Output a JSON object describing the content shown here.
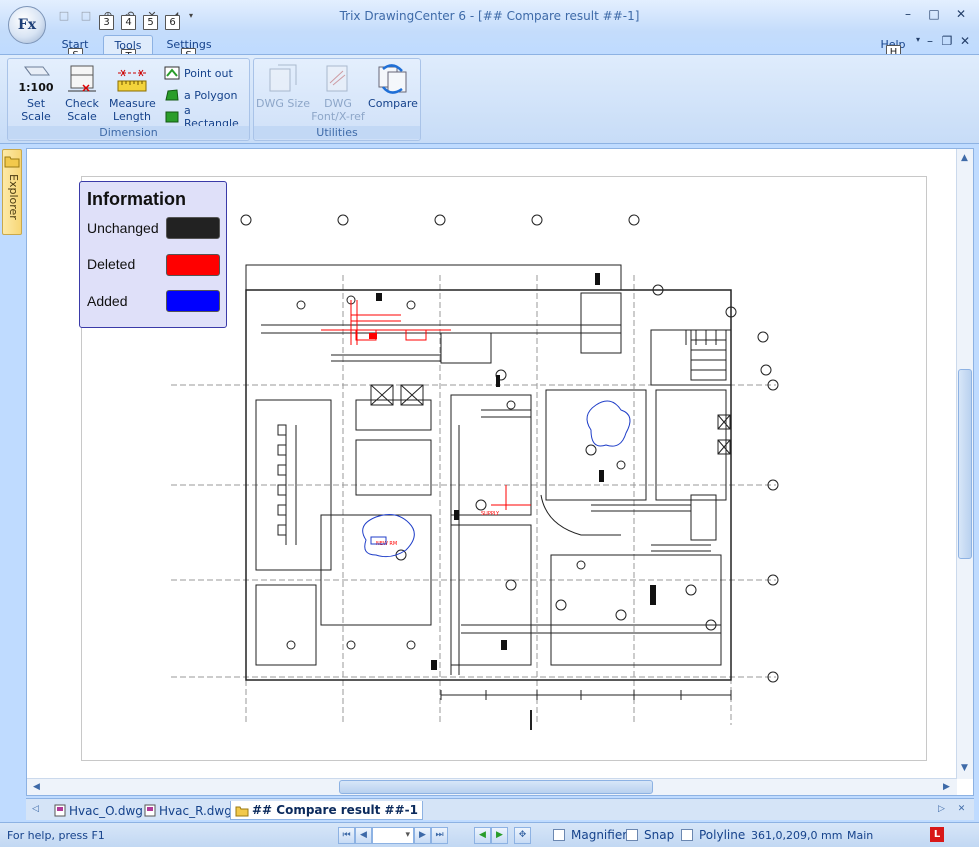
{
  "app": {
    "title": "Trix DrawingCenter 6 - [## Compare result ##-1]",
    "orb_label": "Fx"
  },
  "qat": {
    "keytips": [
      "3",
      "4",
      "5",
      "6"
    ]
  },
  "window_controls": {
    "minimize": "–",
    "maximize": "□",
    "close": "✕"
  },
  "tabs": [
    {
      "label": "Start",
      "keytip": "S"
    },
    {
      "label": "Tools",
      "keytip": "T"
    },
    {
      "label": "Settings",
      "keytip": "S"
    }
  ],
  "help": {
    "label": "Help",
    "keytip": "H"
  },
  "ribbon": {
    "dimension": {
      "label": "Dimension",
      "set_scale": "Set Scale",
      "check_scale": "Check Scale",
      "measure_length": "Measure Length",
      "point_out": "Point  out",
      "a_polygon": "a Polygon",
      "a_rectangle": "a Rectangle",
      "scale_text": "1:100"
    },
    "utilities": {
      "label": "Utilities",
      "dwg_size": "DWG Size",
      "dwg_font_xref": "DWG Font/X-ref",
      "compare": "Compare"
    }
  },
  "explorer": {
    "label": "Explorer"
  },
  "legend": {
    "title": "Information",
    "items": [
      {
        "label": "Unchanged",
        "color": "#222222"
      },
      {
        "label": "Deleted",
        "color": "#ff0000"
      },
      {
        "label": "Added",
        "color": "#0000ff"
      }
    ]
  },
  "doc_tabs": [
    {
      "label": "Hvac_O.dwg",
      "active": false
    },
    {
      "label": "Hvac_R.dwg",
      "active": false
    },
    {
      "label": "## Compare result ##-1",
      "active": true
    }
  ],
  "status": {
    "help_text": "For help, press F1",
    "magnifier": "Magnifier",
    "snap": "Snap",
    "polyline": "Polyline",
    "coords": "361,0,209,0 mm",
    "mode": "Main",
    "badge": "L"
  }
}
